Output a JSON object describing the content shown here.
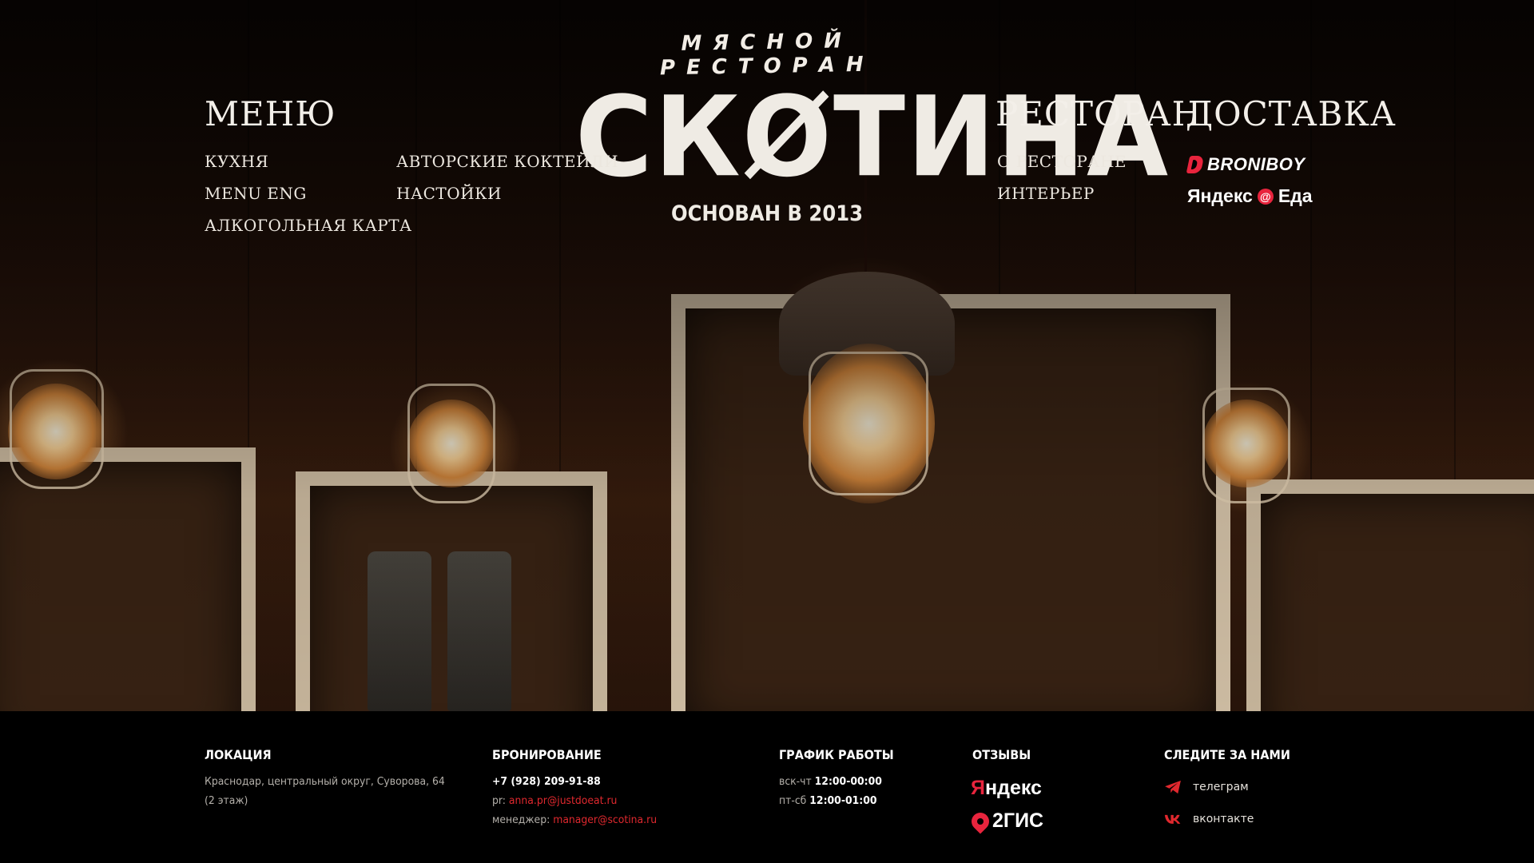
{
  "logo": {
    "subtitle": "МЯСНОЙ РЕСТОРАН",
    "title": "СКØТИНА",
    "founded": "ОСНОВАН В 2013"
  },
  "menu": {
    "title": "МЕНЮ",
    "col1": [
      "КУХНЯ",
      "MENU ENG",
      "АЛКОГОЛЬНАЯ КАРТА"
    ],
    "col2": [
      "АВТОРСКИЕ КОКТЕЙЛИ",
      "НАСТОЙКИ"
    ]
  },
  "restaurant": {
    "title": "РЕСТОРАН",
    "links": [
      "О РЕСТОРАНЕ",
      "ИНТЕРЬЕР"
    ]
  },
  "delivery": {
    "title": "ДОСТАВКА",
    "broniboy": "BRONIBOY",
    "yandex_eda_left": "Яндекс",
    "yandex_eda_right": "Еда"
  },
  "footer": {
    "location": {
      "title": "ЛОКАЦИЯ",
      "line1": "Краснодар, центральный округ, Суворова, 64",
      "line2": "(2 этаж)"
    },
    "booking": {
      "title": "БРОНИРОВАНИЕ",
      "phone": "+7 (928) 209-91-88",
      "pr_label": "pr:",
      "pr_email": "anna.pr@justdoeat.ru",
      "manager_label": "менеджер:",
      "manager_email": "manager@scotina.ru"
    },
    "schedule": {
      "title": "ГРАФИК РАБОТЫ",
      "row1_days": "вск-чт",
      "row1_time": "12:00-00:00",
      "row2_days": "пт-сб",
      "row2_time": "12:00-01:00"
    },
    "reviews": {
      "title": "ОТЗЫВЫ",
      "yandex_y": "Я",
      "yandex_rest": "ндекс",
      "gis": "2ГИС"
    },
    "follow": {
      "title": "СЛЕДИТЕ ЗА НАМИ",
      "telegram": "телеграм",
      "vk": "вконтакте"
    }
  },
  "colors": {
    "accent_red": "#e0282e",
    "footer_bg": "#000000"
  }
}
